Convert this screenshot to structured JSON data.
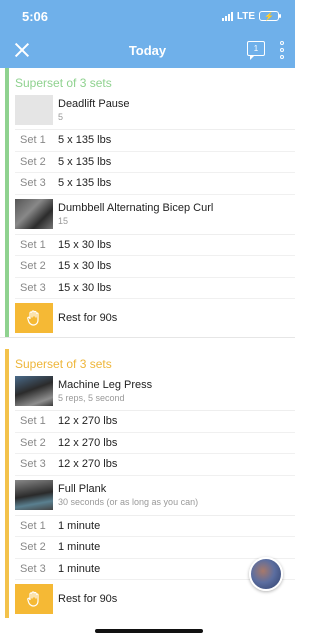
{
  "status": {
    "time": "5:06",
    "network": "LTE"
  },
  "nav": {
    "title": "Today",
    "chat_badge": "1"
  },
  "supersets": [
    {
      "header": "Superset of 3 sets",
      "color": "#8fd28f",
      "exercises": [
        {
          "name": "Deadlift Pause",
          "sub": "5",
          "thumb": "blank",
          "sets": [
            {
              "label": "Set 1",
              "value": "5 x 135 lbs"
            },
            {
              "label": "Set 2",
              "value": "5 x 135 lbs"
            },
            {
              "label": "Set 3",
              "value": "5 x 135 lbs"
            }
          ]
        },
        {
          "name": "Dumbbell Alternating Bicep Curl",
          "sub": "15",
          "thumb": "photo",
          "sets": [
            {
              "label": "Set 1",
              "value": "15 x 30 lbs"
            },
            {
              "label": "Set 2",
              "value": "15 x 30 lbs"
            },
            {
              "label": "Set 3",
              "value": "15 x 30 lbs"
            }
          ]
        }
      ],
      "rest": "Rest for 90s"
    },
    {
      "header": "Superset of 3 sets",
      "color": "#eeb63a",
      "exercises": [
        {
          "name": "Machine Leg Press",
          "sub": "5 reps, 5 second",
          "thumb": "photo2",
          "sets": [
            {
              "label": "Set 1",
              "value": "12 x 270 lbs"
            },
            {
              "label": "Set 2",
              "value": "12 x 270 lbs"
            },
            {
              "label": "Set 3",
              "value": "12 x 270 lbs"
            }
          ]
        },
        {
          "name": "Full Plank",
          "sub": "30 seconds (or as long as you can)",
          "thumb": "photo3",
          "sets": [
            {
              "label": "Set 1",
              "value": "1 minute"
            },
            {
              "label": "Set 2",
              "value": "1 minute"
            },
            {
              "label": "Set 3",
              "value": "1 minute"
            }
          ]
        }
      ],
      "rest": "Rest for 90s"
    }
  ],
  "colors": {
    "nav": "#6fb0ea",
    "rest_icon": "#f5b935"
  },
  "icons": {
    "close": "close-icon",
    "chat": "chat-icon",
    "more": "more-vertical-icon",
    "rest": "hand-icon"
  }
}
